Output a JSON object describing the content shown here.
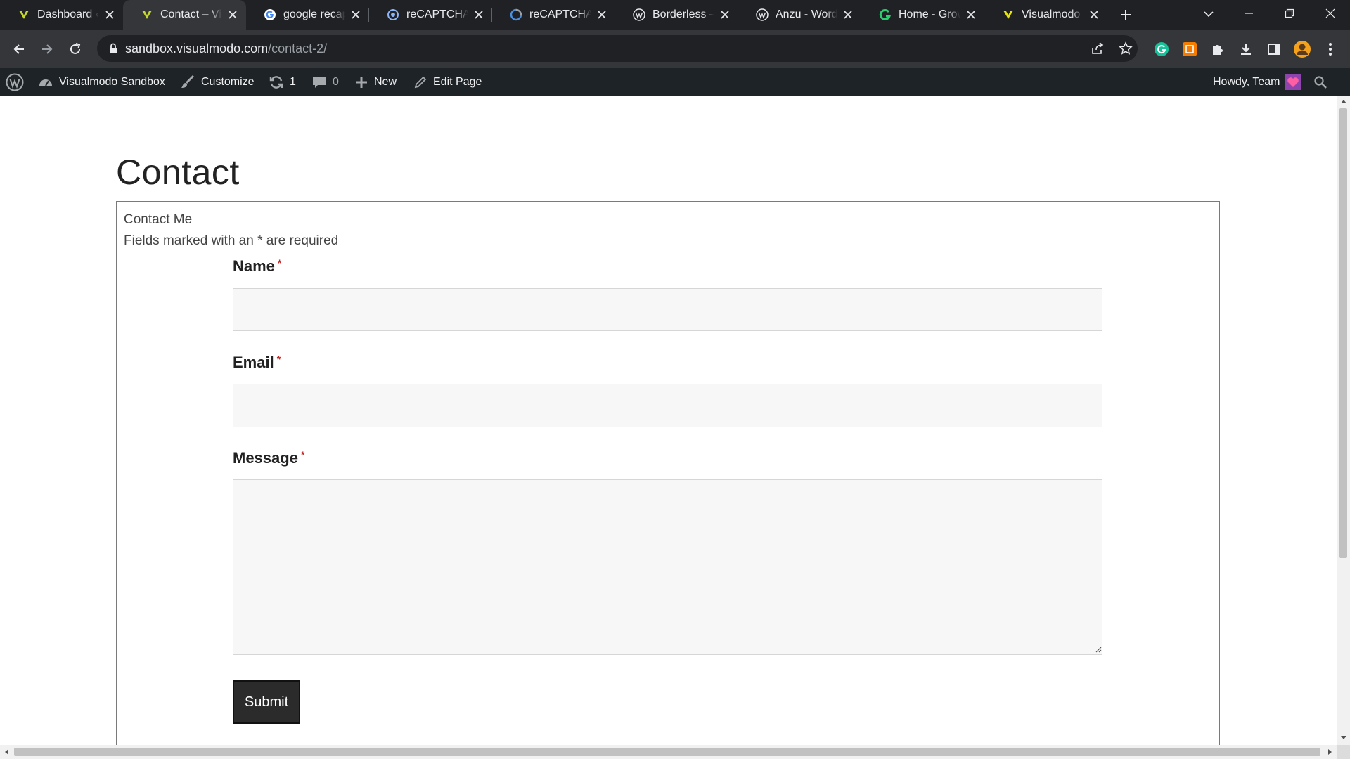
{
  "browser": {
    "tabs": [
      {
        "title": "Dashboard ‹ Visualmodo",
        "icon": "visualmodo-v-icon"
      },
      {
        "title": "Contact – Visualmodo",
        "icon": "visualmodo-v-icon",
        "active": true
      },
      {
        "title": "google recaptcha",
        "icon": "google-g-icon"
      },
      {
        "title": "reCAPTCHA",
        "icon": "recaptcha-icon"
      },
      {
        "title": "reCAPTCHA",
        "icon": "recaptcha-icon"
      },
      {
        "title": "Borderless – WordPress",
        "icon": "wordpress-icon"
      },
      {
        "title": "Anzu - WordPress",
        "icon": "wordpress-icon"
      },
      {
        "title": "Home - Grow",
        "icon": "grow-icon"
      },
      {
        "title": "Visualmodo -",
        "icon": "visualmodo-v-icon"
      }
    ],
    "url_domain": "sandbox.visualmodo.com",
    "url_path": "/contact-2/"
  },
  "adminbar": {
    "site_name": "Visualmodo Sandbox",
    "customize": "Customize",
    "updates_count": "1",
    "comments_count": "0",
    "new_label": "New",
    "edit_page": "Edit Page",
    "howdy": "Howdy, Team"
  },
  "page": {
    "title": "Contact",
    "form": {
      "heading": "Contact Me",
      "note": "Fields marked with an * are required",
      "fields": [
        {
          "label": "Name",
          "required_mark": "*",
          "value": ""
        },
        {
          "label": "Email",
          "required_mark": "*",
          "value": ""
        },
        {
          "label": "Message",
          "required_mark": "*",
          "value": ""
        }
      ],
      "submit_label": "Submit"
    }
  },
  "colors": {
    "tab_strip": "#202124",
    "toolbar": "#35363a",
    "adminbar": "#1d2327",
    "submit_bg": "#2b2b2b",
    "required": "#c62828"
  }
}
